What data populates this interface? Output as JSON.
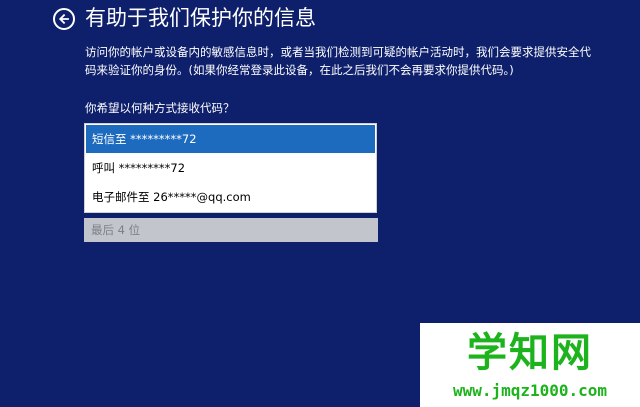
{
  "header": {
    "back_icon": "back-arrow-circle-icon",
    "title": "有助于我们保护你的信息"
  },
  "description": "访问你的帐户或设备内的敏感信息时，或者当我们检测到可疑的帐户活动时，我们会要求提供安全代码来验证你的身份。(如果你经常登录此设备，在此之后我们不会再要求你提供代码。)",
  "question": "你希望以何种方式接收代码？",
  "options": [
    {
      "label": "短信至 *********72",
      "selected": true
    },
    {
      "label": "呼叫 *********72",
      "selected": false
    },
    {
      "label": "电子邮件至 26*****@qq.com",
      "selected": false
    }
  ],
  "code_input": {
    "value": "",
    "placeholder": "最后 4 位"
  },
  "watermark": {
    "text": "学知网",
    "url": "www.jmqz1000.com"
  },
  "colors": {
    "background": "#0e1f6b",
    "selected": "#1c6bbf",
    "input_bg": "#c3c5cc",
    "watermark_green": "#1db31d"
  }
}
